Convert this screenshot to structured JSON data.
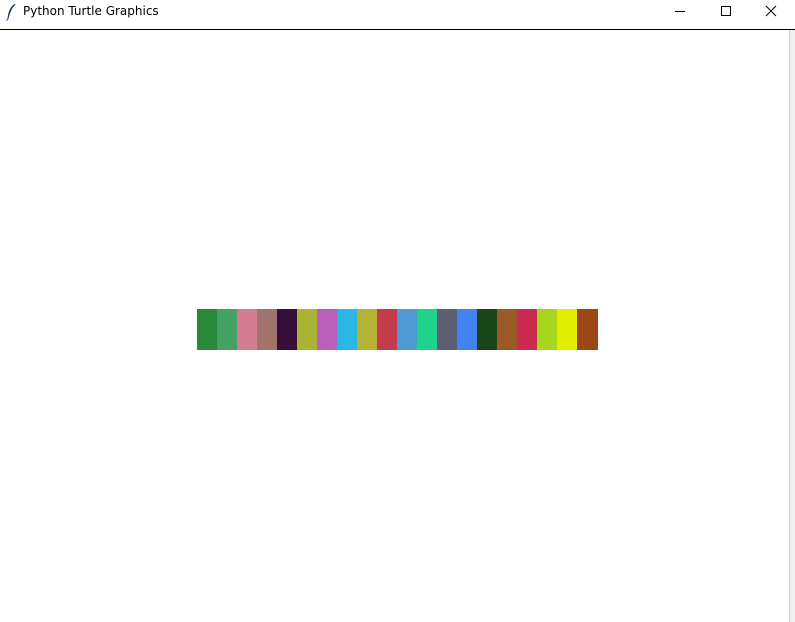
{
  "window": {
    "title": "Python Turtle Graphics",
    "icon": "feather-icon",
    "controls": [
      "minimize-icon",
      "maximize-icon",
      "close-icon"
    ]
  },
  "canvas": {
    "background": "#ffffff",
    "swatch_colors": [
      "#2a8a3a",
      "#44a263",
      "#d47c92",
      "#a0736c",
      "#350f3a",
      "#a9b435",
      "#bb60ba",
      "#2ab7e6",
      "#b4b232",
      "#c43c4b",
      "#4f9ad3",
      "#1fd38c",
      "#5e5e72",
      "#4282f1",
      "#1a4516",
      "#995a27",
      "#cd2a50",
      "#a7d61e",
      "#e3ed00",
      "#9e4716"
    ]
  }
}
